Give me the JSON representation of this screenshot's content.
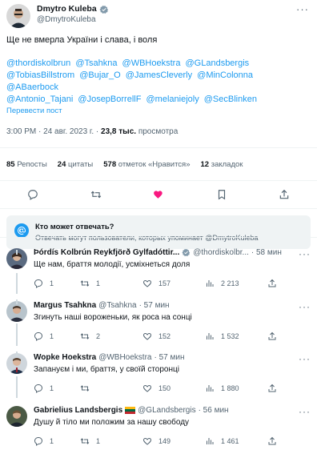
{
  "tweet": {
    "author_name": "Dmytro Kuleba",
    "author_handle": "@DmytroKuleba",
    "text": "Ще не вмерла України і слава, і воля",
    "mentions": [
      "@thordiskolbrun",
      "@Tsahkna",
      "@WBHoekstra",
      "@GLandsbergis",
      "@TobiasBillstrom",
      "@Bujar_O",
      "@JamesCleverly",
      "@MinColonna",
      "@ABaerbock",
      "@Antonio_Tajani",
      "@JosepBorrellF",
      "@melaniejoly",
      "@SecBlinken"
    ],
    "translate": "Перевести пост",
    "time": "3:00 PM · 24 авг. 2023 г. · ",
    "views_count": "23,8 тыс.",
    "views_label": " просмотра"
  },
  "stats": [
    {
      "num": "85",
      "label": "Репосты"
    },
    {
      "num": "24",
      "label": "цитаты"
    },
    {
      "num": "578",
      "label": "отметок «Нравится»"
    },
    {
      "num": "12",
      "label": "закладок"
    }
  ],
  "who_can_reply": {
    "title": "Кто может отвечать?",
    "desc": "Отвечать могут пользователи, которых упоминает @DmytroKuleba"
  },
  "colors": {
    "accent": "#1d9bf0",
    "like": "#f91880",
    "text": "#0f1419",
    "muted": "#536471"
  },
  "replies": [
    {
      "name": "Þórdís Kolbrún Reykfjörð Gylfadóttir...",
      "handle": "@thordiskolbr...",
      "time": "· 58 мин",
      "text": "Ще нам, браття молодії, усміхнеться доля",
      "replies": "1",
      "reposts": "1",
      "likes": "157",
      "views": "2 213"
    },
    {
      "name": "Margus Tsahkna",
      "handle": "@Tsahkna",
      "time": "· 57 мин",
      "text": "Згинуть наші вороженьки, як роса на сонці",
      "replies": "1",
      "reposts": "2",
      "likes": "152",
      "views": "1 532"
    },
    {
      "name": "Wopke Hoekstra",
      "handle": "@WBHoekstra",
      "time": "· 57 мин",
      "text": "Запануєм і ми, браття, у своїй сторонці",
      "replies": "1",
      "reposts": "",
      "likes": "150",
      "views": "1 880"
    },
    {
      "name": "Gabrielius Landsbergis",
      "handle": "@GLandsbergis",
      "time": "· 56 мин",
      "text": "Душу й тіло ми положим за нашу свободу",
      "replies": "1",
      "reposts": "1",
      "likes": "149",
      "views": "1 461"
    }
  ]
}
